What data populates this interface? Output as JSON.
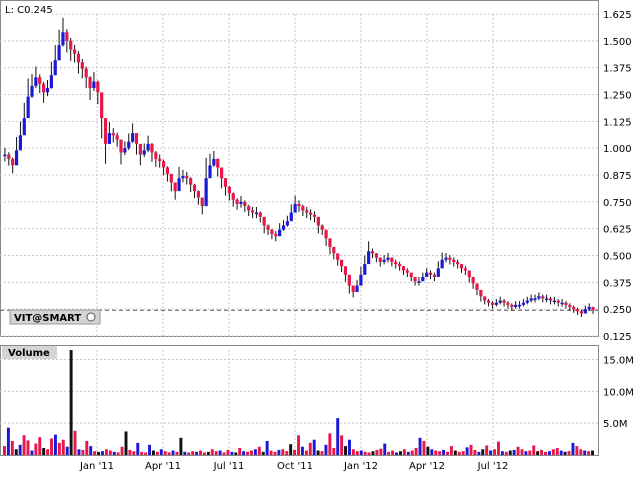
{
  "chart_data": [
    {
      "type": "bar",
      "title": "L: C0.245",
      "symbol_label": "VIT@SMART",
      "ylim": [
        0.125,
        1.625
      ],
      "y_ticks": [
        "1.625",
        "1.500",
        "1.375",
        "1.250",
        "1.125",
        "1.000",
        "0.875",
        "0.750",
        "0.625",
        "0.500",
        "0.375",
        "0.250",
        "0.125"
      ],
      "last_value": 0.245,
      "grid": true,
      "series": [
        {
          "values": [
            0.97,
            0.95,
            0.92,
            0.99,
            1.06,
            1.14,
            1.24,
            1.29,
            1.33,
            1.3,
            1.26,
            1.28,
            1.34,
            1.41,
            1.48,
            1.54,
            1.5,
            1.46,
            1.44,
            1.4,
            1.37,
            1.33,
            1.28,
            1.31,
            1.26,
            1.14,
            1.02,
            1.07,
            1.06,
            1.04,
            0.98,
            1.0,
            1.03,
            1.07,
            1.02,
            0.97,
            0.99,
            1.02,
            0.98,
            0.95,
            0.94,
            0.91,
            0.88,
            0.84,
            0.8,
            0.86,
            0.87,
            0.86,
            0.83,
            0.8,
            0.77,
            0.73,
            0.86,
            0.92,
            0.95,
            0.91,
            0.86,
            0.82,
            0.79,
            0.76,
            0.74,
            0.75,
            0.73,
            0.71,
            0.7,
            0.7,
            0.68,
            0.64,
            0.62,
            0.6,
            0.59,
            0.62,
            0.64,
            0.66,
            0.7,
            0.74,
            0.73,
            0.71,
            0.7,
            0.69,
            0.68,
            0.64,
            0.62,
            0.58,
            0.54,
            0.51,
            0.48,
            0.45,
            0.41,
            0.36,
            0.33,
            0.36,
            0.41,
            0.46,
            0.52,
            0.51,
            0.49,
            0.47,
            0.48,
            0.49,
            0.47,
            0.46,
            0.45,
            0.43,
            0.42,
            0.4,
            0.38,
            0.38,
            0.4,
            0.42,
            0.41,
            0.4,
            0.44,
            0.48,
            0.49,
            0.48,
            0.47,
            0.46,
            0.44,
            0.43,
            0.4,
            0.37,
            0.34,
            0.31,
            0.29,
            0.28,
            0.27,
            0.28,
            0.29,
            0.28,
            0.27,
            0.26,
            0.27,
            0.27,
            0.28,
            0.29,
            0.3,
            0.3,
            0.31,
            0.3,
            0.3,
            0.29,
            0.29,
            0.28,
            0.28,
            0.27,
            0.26,
            0.25,
            0.24,
            0.23,
            0.25,
            0.26,
            0.245
          ]
        }
      ]
    },
    {
      "type": "bar",
      "title": "Volume",
      "ylim": [
        0,
        16500000
      ],
      "y_ticks": [
        "15.0M",
        "10.0M",
        "5.0M"
      ],
      "x_tick_labels": [
        "Jan '11",
        "Apr '11",
        "Jul '11",
        "Oct '11",
        "Jan '12",
        "Apr '12",
        "Jul '12"
      ],
      "series": [
        {
          "values": [
            1400000,
            4300000,
            2200000,
            900000,
            1600000,
            3100000,
            2300000,
            700000,
            1800000,
            2800000,
            1100000,
            900000,
            2600000,
            3200000,
            1900000,
            2400000,
            1300000,
            16500000,
            3800000,
            900000,
            800000,
            2200000,
            1400000,
            600000,
            500000,
            600000,
            900000,
            700000,
            500000,
            400000,
            1300000,
            3700000,
            800000,
            600000,
            1900000,
            500000,
            400000,
            1600000,
            700000,
            500000,
            900000,
            600000,
            400000,
            700000,
            500000,
            2700000,
            500000,
            400000,
            600000,
            500000,
            700000,
            400000,
            500000,
            900000,
            600000,
            700000,
            400000,
            800000,
            500000,
            400000,
            1100000,
            600000,
            500000,
            700000,
            900000,
            1300000,
            500000,
            2200000,
            700000,
            500000,
            800000,
            900000,
            600000,
            1700000,
            800000,
            3100000,
            1300000,
            700000,
            1900000,
            2400000,
            700000,
            600000,
            1600000,
            3400000,
            1100000,
            5800000,
            3100000,
            1400000,
            2400000,
            900000,
            600000,
            700000,
            500000,
            400000,
            600000,
            800000,
            1000000,
            1800000,
            500000,
            700000,
            400000,
            600000,
            900000,
            500000,
            700000,
            1100000,
            2700000,
            2200000,
            1300000,
            900000,
            700000,
            600000,
            800000,
            500000,
            1400000,
            700000,
            500000,
            600000,
            1200000,
            1600000,
            800000,
            500000,
            900000,
            1500000,
            700000,
            900000,
            2100000,
            600000,
            500000,
            700000,
            800000,
            1300000,
            900000,
            600000,
            700000,
            1500000,
            600000,
            800000,
            500000,
            600000,
            900000,
            1100000,
            700000,
            500000,
            600000,
            1900000,
            1400000,
            900000,
            700000,
            600000,
            700000
          ]
        }
      ]
    }
  ]
}
